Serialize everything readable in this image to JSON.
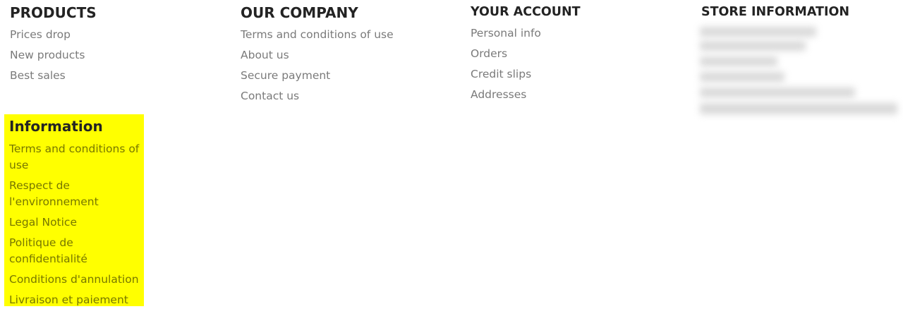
{
  "products": {
    "title": "PRODUCTS",
    "links": [
      "Prices drop",
      "New products",
      "Best sales"
    ]
  },
  "company": {
    "title": "OUR COMPANY",
    "links": [
      "Terms and conditions of use",
      "About us",
      "Secure payment",
      "Contact us"
    ]
  },
  "account": {
    "title": "YOUR ACCOUNT",
    "links": [
      "Personal info",
      "Orders",
      "Credit slips",
      "Addresses"
    ]
  },
  "store": {
    "title": "STORE INFORMATION"
  },
  "information": {
    "title": "Information",
    "highlight_color": "#ffff00",
    "links": [
      "Terms and conditions of use",
      "Respect de l'environnement",
      "Legal Notice",
      "Politique de confidentialité",
      "Conditions d'annulation",
      "Livraison et paiement"
    ]
  }
}
